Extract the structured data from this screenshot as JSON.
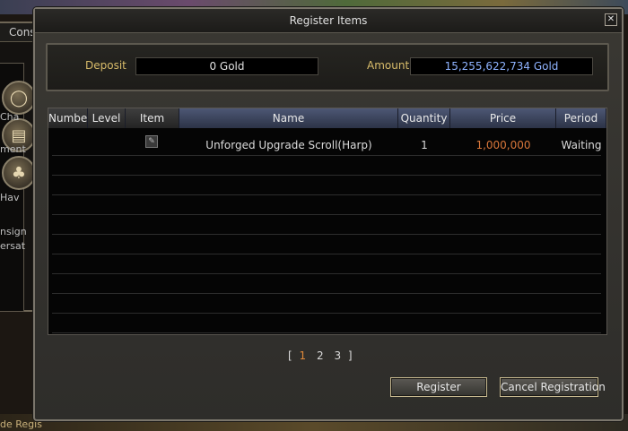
{
  "background": {
    "window_title": "Cons",
    "side_texts": [
      "Cha",
      "ment",
      "Hav",
      "nsign",
      "ersat"
    ],
    "bottom_label": "de Regis"
  },
  "dialog": {
    "title": "Register Items",
    "close_symbol": "✕",
    "deposit_label": "Deposit",
    "deposit_value": "0 Gold",
    "amount_label": "Amount",
    "amount_value": "15,255,622,734 Gold",
    "accent_gold": "#d8bc6a",
    "amount_color": "#8fb3ff"
  },
  "table": {
    "headers": [
      "Number",
      "Level",
      "Item",
      "Name",
      "Quantity",
      "Price",
      "Period"
    ],
    "rows": [
      {
        "number": "",
        "level": "",
        "item_icon": "scroll-icon",
        "name": "Unforged Upgrade Scroll(Harp)",
        "quantity": "1",
        "price": "1,000,000",
        "period": "Waiting"
      }
    ],
    "empty_row_count": 9,
    "price_color": "#d9773a"
  },
  "pagination": {
    "open": "[",
    "pages": [
      "1",
      "2",
      "3"
    ],
    "current": "1",
    "close": "]"
  },
  "buttons": {
    "register": "Register",
    "cancel": "Cancel Registration"
  }
}
